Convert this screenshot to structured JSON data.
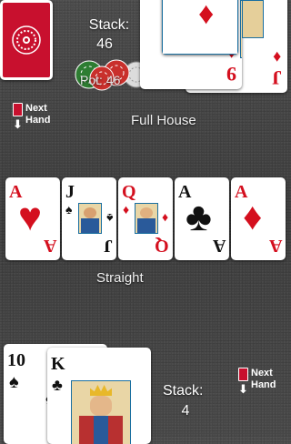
{
  "opponent": {
    "stack_label": "Stack:",
    "stack_value": "46",
    "pot_label": "Pot: 46",
    "hand_name": "Full House",
    "next_hand": {
      "line1": "Next",
      "line2": "Hand"
    },
    "cards": [
      {
        "rank": "",
        "suit": "♦",
        "color": "red"
      },
      {
        "rank": "9",
        "suit": "♦",
        "color": "red"
      },
      {
        "rank": "J",
        "suit": "♦",
        "color": "red"
      }
    ]
  },
  "community": [
    {
      "rank": "A",
      "suit": "♥",
      "color": "red"
    },
    {
      "rank": "J",
      "suit": "♠",
      "color": "black"
    },
    {
      "rank": "Q",
      "suit": "♦",
      "color": "red"
    },
    {
      "rank": "A",
      "suit": "♣",
      "color": "black"
    },
    {
      "rank": "A",
      "suit": "♦",
      "color": "red"
    }
  ],
  "player": {
    "hand_name": "Straight",
    "stack_label": "Stack:",
    "stack_value": "4",
    "next_hand": {
      "line1": "Next",
      "line2": "Hand"
    },
    "cards": [
      {
        "rank": "10",
        "suit": "♠",
        "color": "black"
      },
      {
        "rank": "K",
        "suit": "♣",
        "color": "black"
      }
    ]
  }
}
